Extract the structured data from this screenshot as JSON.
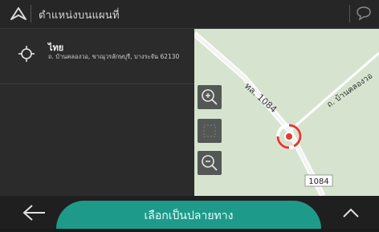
{
  "header": {
    "title": "ตำแหน่งบนแผนที่"
  },
  "location": {
    "name": "ไทย",
    "address": "ถ. บ้านคลองวอ, ขาณุวรลักษบุรี, บางระจัน 62130"
  },
  "map": {
    "road_label_main": "ทล. 1084",
    "road_label_side": "ถ. บ้านคลองวอ",
    "route_number": "1084"
  },
  "footer": {
    "select_label": "เลือกเป็นปลายทาง"
  },
  "colors": {
    "accent": "#1e9a8a",
    "marker": "#e53935",
    "map_bg": "#d6e4cf"
  }
}
